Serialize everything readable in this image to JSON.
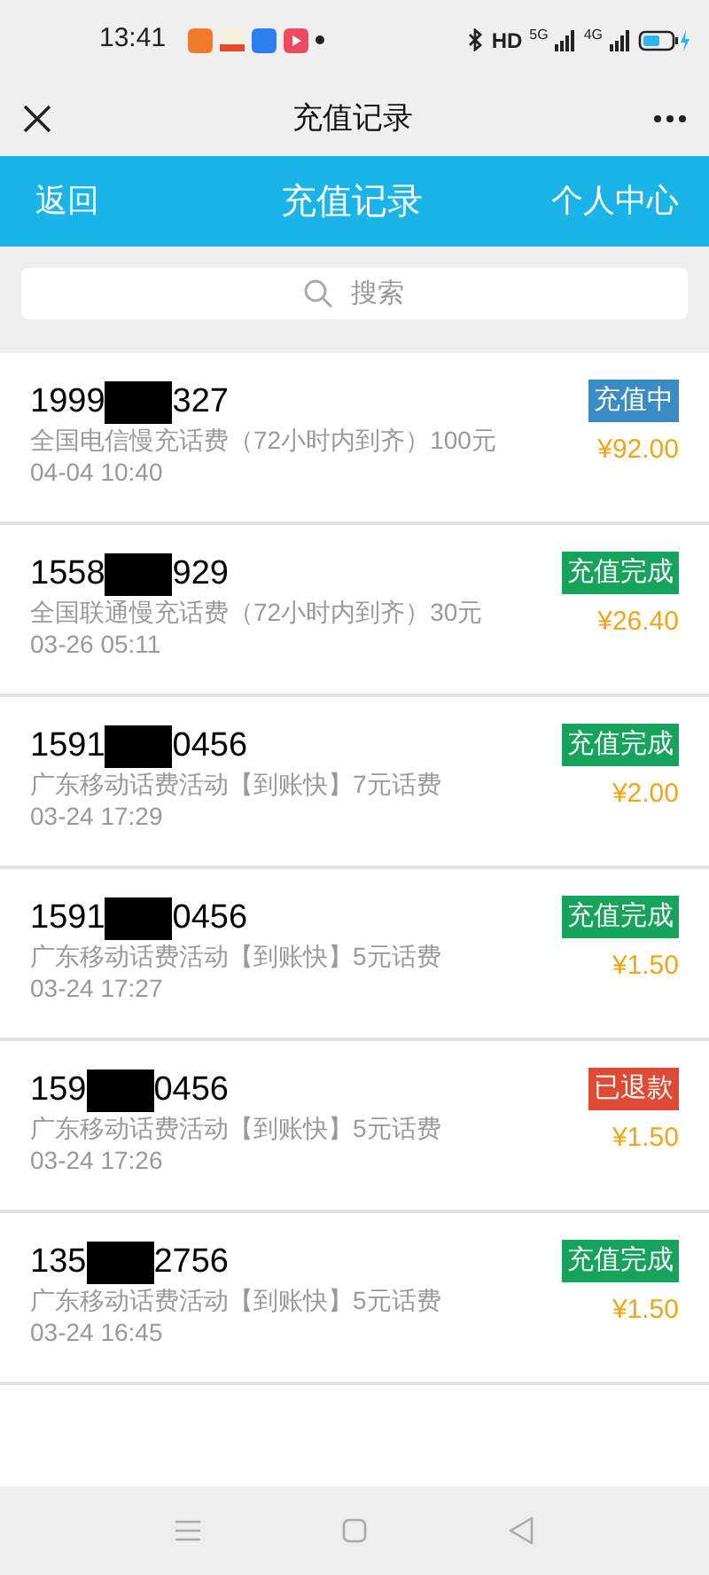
{
  "status_bar": {
    "time": "13:41",
    "hd": "HD",
    "signal_1": "5G",
    "signal_2": "4G"
  },
  "title_bar": {
    "title": "充值记录"
  },
  "header": {
    "back": "返回",
    "title": "充值记录",
    "account": "个人中心"
  },
  "search": {
    "placeholder": "搜索"
  },
  "records": [
    {
      "phone_start": "1999",
      "phone_end": "327",
      "product": "全国电信慢充话费（72小时内到齐）100元",
      "time": "04-04 10:40",
      "status": "充值中",
      "color": "#3b8bc4",
      "price": "¥92.00"
    },
    {
      "phone_start": "1558",
      "phone_end": "929",
      "product": "全国联通慢充话费（72小时内到齐）30元",
      "time": "03-26 05:11",
      "status": "充值完成",
      "color": "#16a35c",
      "price": "¥26.40"
    },
    {
      "phone_start": "1591",
      "phone_end": "0456",
      "product": "广东移动话费活动【到账快】7元话费",
      "time": "03-24 17:29",
      "status": "充值完成",
      "color": "#16a35c",
      "price": "¥2.00"
    },
    {
      "phone_start": "1591",
      "phone_end": "0456",
      "product": "广东移动话费活动【到账快】5元话费",
      "time": "03-24 17:27",
      "status": "充值完成",
      "color": "#16a35c",
      "price": "¥1.50"
    },
    {
      "phone_start": "159",
      "phone_end": "0456",
      "product": "广东移动话费活动【到账快】5元话费",
      "time": "03-24 17:26",
      "status": "已退款",
      "color": "#e04a35",
      "price": "¥1.50"
    },
    {
      "phone_start": "135",
      "phone_end": "2756",
      "product": "广东移动话费活动【到账快】5元话费",
      "time": "03-24 16:45",
      "status": "充值完成",
      "color": "#16a35c",
      "price": "¥1.50"
    }
  ]
}
